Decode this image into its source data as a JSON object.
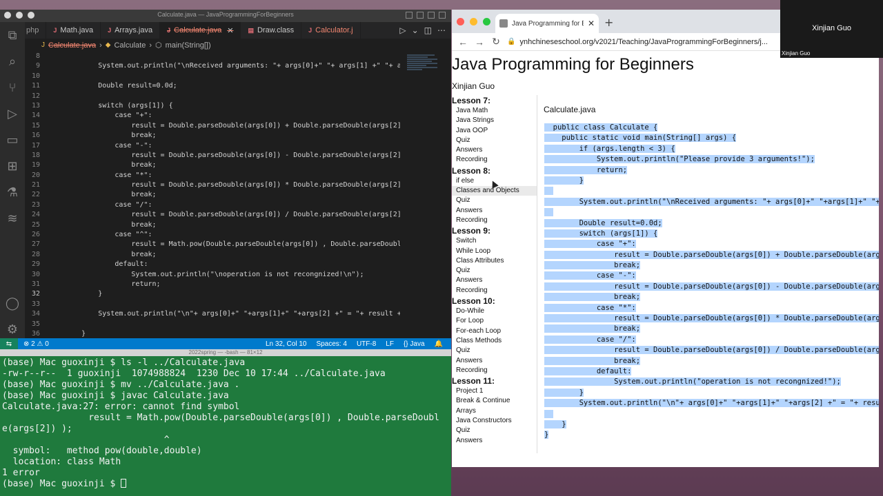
{
  "vscode": {
    "window_title": "Calculate.java — JavaProgrammingForBeginners",
    "tabs": [
      {
        "label": "php"
      },
      {
        "label": "Math.java"
      },
      {
        "label": "Arrays.java"
      },
      {
        "label": "Calculate.java",
        "active": true
      },
      {
        "label": "Draw.class"
      },
      {
        "label": "Calculator.j"
      }
    ],
    "breadcrumbs": {
      "file": "Calculate.java",
      "class": "Calculate",
      "method": "main(String[])"
    },
    "code_lines": [
      {
        "n": "8",
        "text": ""
      },
      {
        "n": "9",
        "text": "            System.out.println(\"\\nReceived arguments: \"+ args[0]+\" \"+ args[1] +\" \"+ args"
      },
      {
        "n": "10",
        "text": ""
      },
      {
        "n": "11",
        "text": "            Double result=0.0d;"
      },
      {
        "n": "12",
        "text": ""
      },
      {
        "n": "13",
        "text": "            switch (args[1]) {"
      },
      {
        "n": "14",
        "text": "                case \"+\":"
      },
      {
        "n": "15",
        "text": "                    result = Double.parseDouble(args[0]) + Double.parseDouble(args[2]);"
      },
      {
        "n": "16",
        "text": "                    break;"
      },
      {
        "n": "17",
        "text": "                case \"-\":"
      },
      {
        "n": "18",
        "text": "                    result = Double.parseDouble(args[0]) - Double.parseDouble(args[2]);"
      },
      {
        "n": "19",
        "text": "                    break;"
      },
      {
        "n": "20",
        "text": "                case \"*\":"
      },
      {
        "n": "21",
        "text": "                    result = Double.parseDouble(args[0]) * Double.parseDouble(args[2]);"
      },
      {
        "n": "22",
        "text": "                    break;"
      },
      {
        "n": "23",
        "text": "                case \"/\":"
      },
      {
        "n": "24",
        "text": "                    result = Double.parseDouble(args[0]) / Double.parseDouble(args[2]);"
      },
      {
        "n": "25",
        "text": "                    break;"
      },
      {
        "n": "26",
        "text": "                case \"^\":"
      },
      {
        "n": "27",
        "text": "                    result = Math.pow(Double.parseDouble(args[0]) , Double.parseDouble(a"
      },
      {
        "n": "28",
        "text": "                    break;"
      },
      {
        "n": "29",
        "text": "                default:"
      },
      {
        "n": "30",
        "text": "                    System.out.println(\"\\noperation is not recongnized!\\n\");"
      },
      {
        "n": "31",
        "text": "                    return;"
      },
      {
        "n": "32",
        "text": "            }"
      },
      {
        "n": "33",
        "text": ""
      },
      {
        "n": "34",
        "text": "            System.out.println(\"\\n\"+ args[0]+\" \"+args[1]+\" \"+args[2] +\" = \"+ result + \"\\n"
      },
      {
        "n": "35",
        "text": ""
      },
      {
        "n": "36",
        "text": "        }"
      }
    ],
    "status": {
      "problems": "⊗ 2 ⚠ 0",
      "position": "Ln 32, Col 10",
      "spaces": "Spaces: 4",
      "encoding": "UTF-8",
      "eol": "LF",
      "language": "{} Java"
    },
    "colors": {
      "status_bar": "#007acc",
      "error_tab": "#f48771"
    }
  },
  "terminal": {
    "title": "2022spring — -bash — 81×12",
    "lines": [
      "(base) Mac guoxinji $ ls -l ../Calculate.java",
      "-rw-r--r--  1 guoxinji  1074988824  1230 Dec 10 17:44 ../Calculate.java",
      "(base) Mac guoxinji $ mv ../Calculate.java .",
      "(base) Mac guoxinji $ javac Calculate.java",
      "Calculate.java:27: error: cannot find symbol",
      "                result = Math.pow(Double.parseDouble(args[0]) , Double.parseDoubl",
      "e(args[2]) );",
      "                              ^",
      "  symbol:   method pow(double,double)",
      "  location: class Math",
      "1 error",
      "(base) Mac guoxinji $ "
    ],
    "background": "#1f7a3d"
  },
  "browser": {
    "tab_title": "Java Programming for Beginners",
    "url": "ynhchineseschool.org/v2021/Teaching/JavaProgrammingForBeginners/j...",
    "page": {
      "title": "Java Programming for Beginners",
      "author": "Xinjian Guo",
      "sidebar": [
        {
          "lesson": "Lesson 7:",
          "items": [
            "Java Math",
            "Java Strings",
            "Java OOP",
            "Quiz",
            "Answers",
            "Recording"
          ]
        },
        {
          "lesson": "Lesson 8:",
          "items": [
            "if else",
            "Classes and Objects",
            "Quiz",
            "Answers",
            "Recording"
          ]
        },
        {
          "lesson": "Lesson 9:",
          "items": [
            "Switch",
            "While Loop",
            "Class Attributes",
            "Quiz",
            "Answers",
            "Recording"
          ]
        },
        {
          "lesson": "Lesson 10:",
          "items": [
            "Do-While",
            "For Loop",
            "For-each Loop",
            "Class Methods",
            "Quiz",
            "Answers",
            "Recording"
          ]
        },
        {
          "lesson": "Lesson 11:",
          "items": [
            "Project 1",
            "Break & Continue",
            "Arrays",
            "Java Constructors",
            "Quiz",
            "Answers"
          ]
        }
      ],
      "file_title": "Calculate.java",
      "code_lines": [
        "  public class Calculate {",
        "    public static void main(String[] args) {",
        "        if (args.length < 3) {",
        "            System.out.println(\"Please provide 3 arguments!\");",
        "            return;",
        "        }",
        "  ",
        "        System.out.println(\"\\nReceived arguments: \"+ args[0]+\" \"+args[1]+\" \"+",
        "  ",
        "        Double result=0.0d;",
        "        switch (args[1]) {",
        "            case \"+\":",
        "                result = Double.parseDouble(args[0]) + Double.parseDouble(arg",
        "                break;",
        "            case \"-\":",
        "                result = Double.parseDouble(args[0]) - Double.parseDouble(arg",
        "                break;",
        "            case \"*\":",
        "                result = Double.parseDouble(args[0]) * Double.parseDouble(arg",
        "                break;",
        "            case \"/\":",
        "                result = Double.parseDouble(args[0]) / Double.parseDouble(arg",
        "                break;",
        "            default:",
        "                System.out.println(\"operation is not recongnized!\");",
        "        }",
        "        System.out.println(\"\\n\"+ args[0]+\" \"+args[1]+\" \"+args[2] +\" = \"+ resu",
        "  ",
        "    }",
        "}"
      ]
    }
  },
  "video": {
    "name": "Xinjian Guo",
    "label": "Xinjian Guo"
  }
}
